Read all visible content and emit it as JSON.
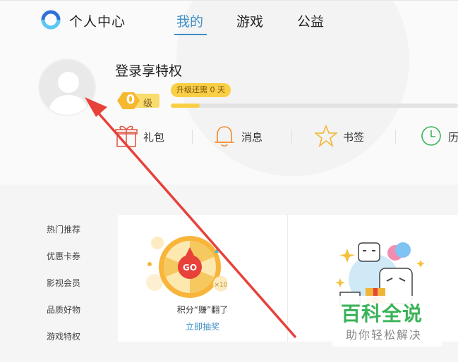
{
  "header": {
    "title": "个人中心",
    "tabs": [
      {
        "label": "我的",
        "active": true
      },
      {
        "label": "游戏",
        "active": false
      },
      {
        "label": "公益",
        "active": false
      }
    ],
    "accent_color": "#3e8fc6"
  },
  "profile": {
    "login_text": "登录享特权",
    "level_number": "0",
    "level_suffix": "级",
    "upgrade_tip": "升级还需 0 天",
    "progress_fraction": 0.1
  },
  "quick_links": [
    {
      "label": "礼包",
      "icon": "gift-icon"
    },
    {
      "label": "消息",
      "icon": "bell-icon"
    },
    {
      "label": "书签",
      "icon": "star-icon"
    },
    {
      "label": "历",
      "icon": "clock-icon"
    }
  ],
  "sidebar": {
    "items": [
      "热门推荐",
      "优惠卡券",
      "影视会员",
      "品质好物",
      "游戏特权"
    ]
  },
  "cards": {
    "lottery": {
      "title": "积分“赚”翻了",
      "link": "立即抽奖",
      "go_label": "GO",
      "multiplier": "×10"
    }
  },
  "watermark": {
    "main": "百科全说",
    "sub": "助你轻松解决"
  }
}
